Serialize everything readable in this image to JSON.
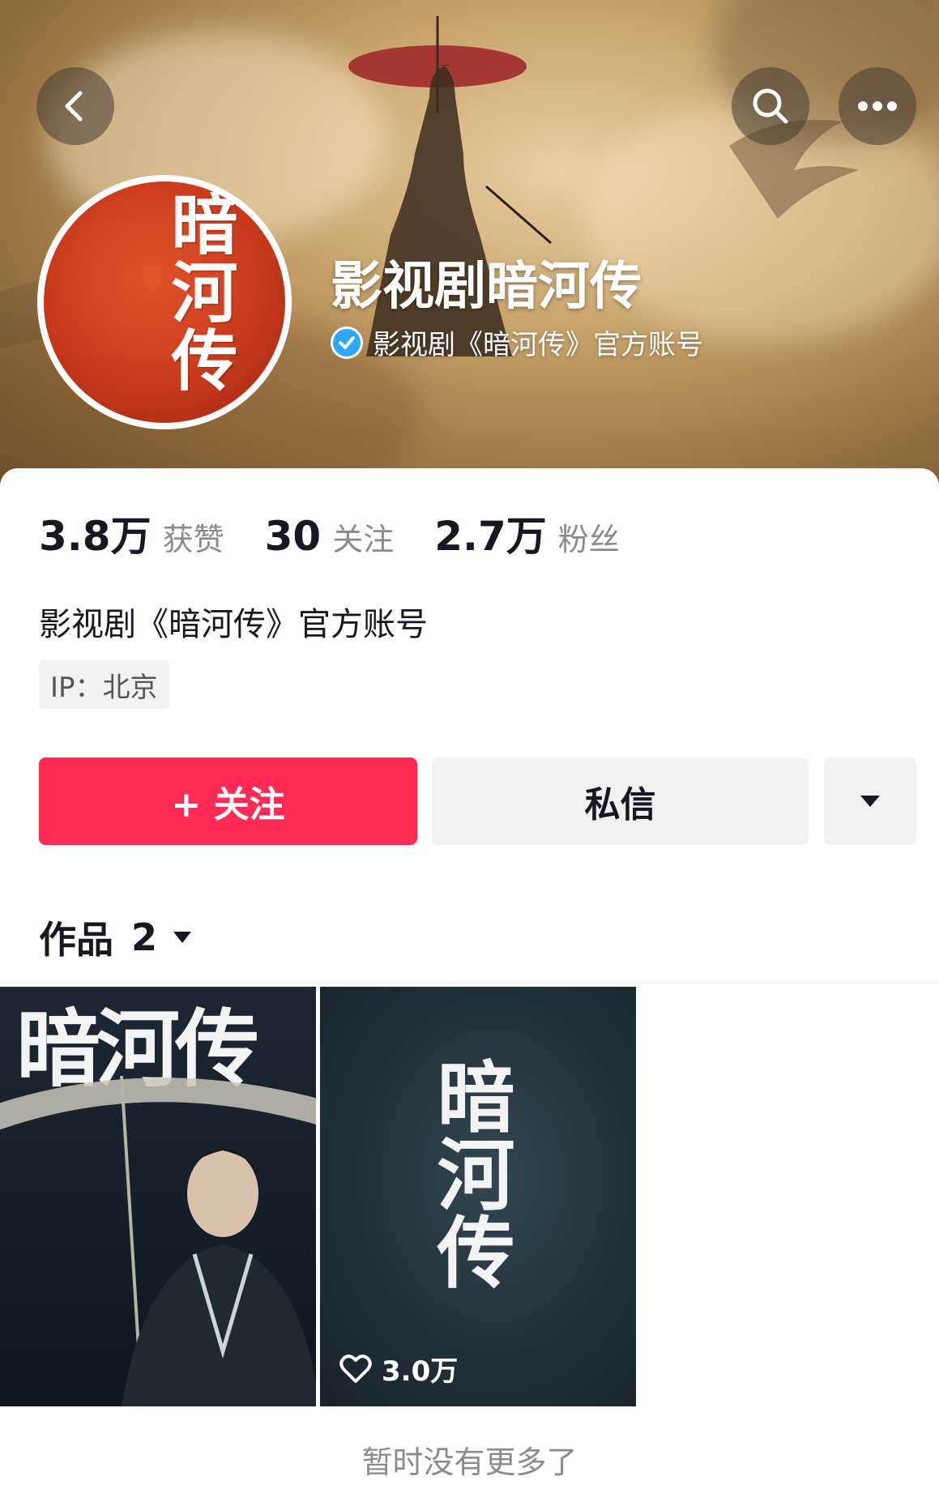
{
  "header": {
    "back_icon": "chevron-left-icon",
    "search_icon": "search-icon",
    "more_icon": "more-horizontal-icon"
  },
  "profile": {
    "avatar_text": "暗河传",
    "name": "影视剧暗河传",
    "verified": true,
    "verified_text": "影视剧《暗河传》官方账号"
  },
  "stats": [
    {
      "value": "3.8万",
      "label": "获赞"
    },
    {
      "value": "30",
      "label": "关注"
    },
    {
      "value": "2.7万",
      "label": "粉丝"
    }
  ],
  "bio": "影视剧《暗河传》官方账号",
  "ip_location": "IP：北京",
  "actions": {
    "follow_label": "+ 关注",
    "message_label": "私信",
    "dropdown_icon": "caret-down-icon"
  },
  "works": {
    "tab_label": "作品",
    "count": "2",
    "items": [
      {
        "poster_title": "暗河传"
      },
      {
        "poster_title": "暗河传",
        "likes": "3.0万"
      }
    ]
  },
  "footer_text": "暂时没有更多了",
  "colors": {
    "accent": "#fe2c55",
    "verify_blue": "#2ea7ff",
    "text_primary": "#161823",
    "text_secondary": "#8a8b91",
    "button_secondary_bg": "#f1f1f2"
  }
}
